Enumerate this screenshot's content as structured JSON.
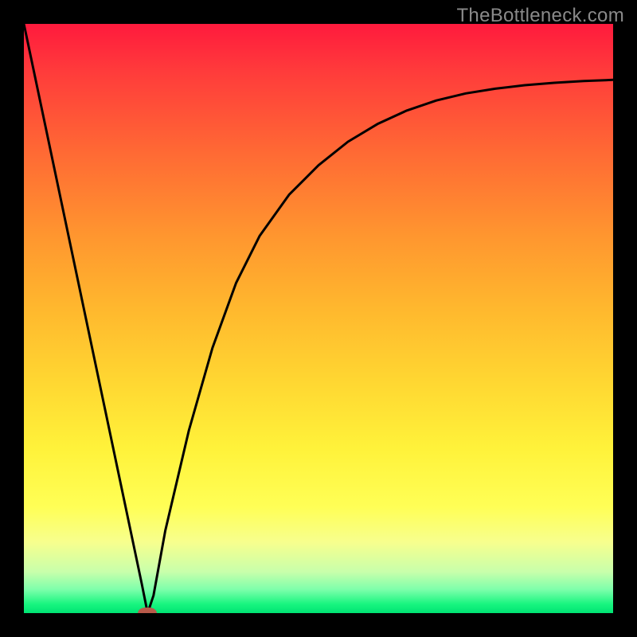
{
  "watermark": {
    "text": "TheBottleneck.com"
  },
  "chart_data": {
    "type": "line",
    "title": "",
    "xlabel": "",
    "ylabel": "",
    "x_range": [
      0,
      100
    ],
    "y_range": [
      0,
      100
    ],
    "background_gradient": {
      "direction": "vertical",
      "stops": [
        {
          "pos": 0.0,
          "color": "#ff1a3d",
          "meaning": "high"
        },
        {
          "pos": 0.5,
          "color": "#ffc531",
          "meaning": "mid"
        },
        {
          "pos": 0.95,
          "color": "#f7ff8e",
          "meaning": "low"
        },
        {
          "pos": 1.0,
          "color": "#00e373",
          "meaning": "zero"
        }
      ]
    },
    "series": [
      {
        "name": "bottleneck-curve",
        "color": "#000000",
        "x": [
          0,
          4,
          8,
          12,
          16,
          20,
          21,
          22,
          24,
          28,
          32,
          36,
          40,
          45,
          50,
          55,
          60,
          65,
          70,
          75,
          80,
          85,
          90,
          95,
          100
        ],
        "y": [
          100,
          81,
          62,
          43,
          24,
          5,
          0,
          3,
          14,
          31,
          45,
          56,
          64,
          71,
          76,
          80,
          83,
          85.3,
          87,
          88.2,
          89,
          89.6,
          90,
          90.3,
          90.5
        ]
      }
    ],
    "marker": {
      "name": "optimal-point",
      "x": 21,
      "y": 0,
      "color": "#b85a4a"
    }
  }
}
